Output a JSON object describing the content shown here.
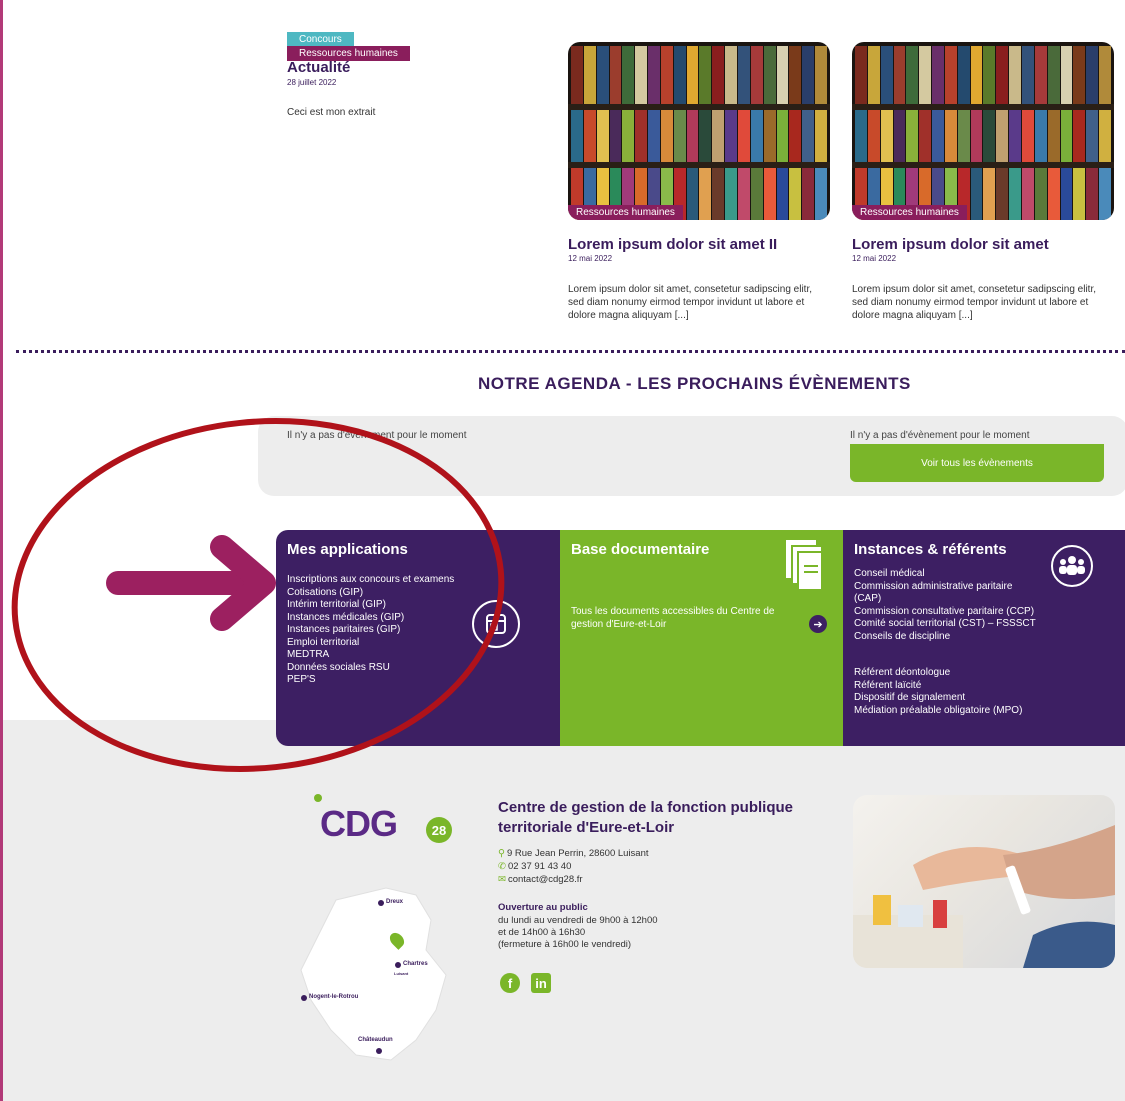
{
  "featured": {
    "tags": [
      "Concours",
      "Ressources humaines"
    ],
    "title": "Actualité",
    "date": "28 juillet 2022",
    "excerpt": "Ceci est mon extrait"
  },
  "cards": [
    {
      "tag": "Ressources humaines",
      "title": "Lorem ipsum dolor sit amet II",
      "date": "12 mai 2022",
      "text": "Lorem ipsum dolor sit amet, consetetur sadipscing elitr, sed diam nonumy eirmod tempor invidunt ut labore et dolore magna aliquyam [...]"
    },
    {
      "tag": "Ressources humaines",
      "title": "Lorem ipsum dolor sit amet",
      "date": "12 mai 2022",
      "text": "Lorem ipsum dolor sit amet, consetetur sadipscing elitr, sed diam nonumy eirmod tempor invidunt ut labore et dolore magna aliquyam [...]"
    }
  ],
  "agenda": {
    "title": "NOTRE AGENDA - LES PROCHAINS ÉVÈNEMENTS",
    "empty_left": "Il n'y a pas d'évènement pour le moment",
    "empty_right": "Il n'y a pas d'évènement pour le moment",
    "button": "Voir tous les évènements"
  },
  "tiles": {
    "apps": {
      "title": "Mes applications",
      "items": [
        "Inscriptions aux concours et examens",
        "Cotisations (GIP)",
        "Intérim territorial (GIP)",
        "Instances médicales (GIP)",
        "Instances paritaires (GIP)",
        "Emploi territorial",
        "MEDTRA",
        "Données sociales RSU",
        "PEP'S"
      ]
    },
    "docs": {
      "title": "Base documentaire",
      "text": "Tous les documents accessibles du Centre de gestion d'Eure-et-Loir"
    },
    "inst": {
      "title": "Instances & référents",
      "items": [
        "Conseil médical",
        "Commission administrative paritaire",
        "(CAP)",
        "Commission consultative paritaire (CCP)",
        "Comité social territorial (CST) – FSSSCT",
        "Conseils de discipline"
      ],
      "items2": [
        "Référent déontologue",
        "Référent laïcité",
        "Dispositif de signalement",
        "Médiation préalable obligatoire (MPO)"
      ]
    }
  },
  "footer": {
    "logo": "CDG",
    "logo_number": "28",
    "org_name": "Centre de gestion de la fonction publique territoriale d'Eure-et-Loir",
    "address": "9 Rue Jean Perrin, 28600 Luisant",
    "phone": "02 37 91 43 40",
    "email": "contact@cdg28.fr",
    "hours_title": "Ouverture au public",
    "hours": [
      "du lundi au vendredi de 9h00 à 12h00",
      "et de 14h00 à 16h30",
      "(fermeture à 16h00 le vendredi)"
    ],
    "social": [
      "f",
      "in"
    ],
    "map_cities": [
      "Dreux",
      "Chartres",
      "Luisant",
      "Nogent-le-Rotrou",
      "Châteaudun"
    ]
  },
  "colors": {
    "purple": "#3d1f63",
    "green": "#7ab629",
    "magenta": "#8a1e5c",
    "teal": "#4eb8c2",
    "annotation_red": "#b0121a",
    "arrow": "#9c2060"
  }
}
